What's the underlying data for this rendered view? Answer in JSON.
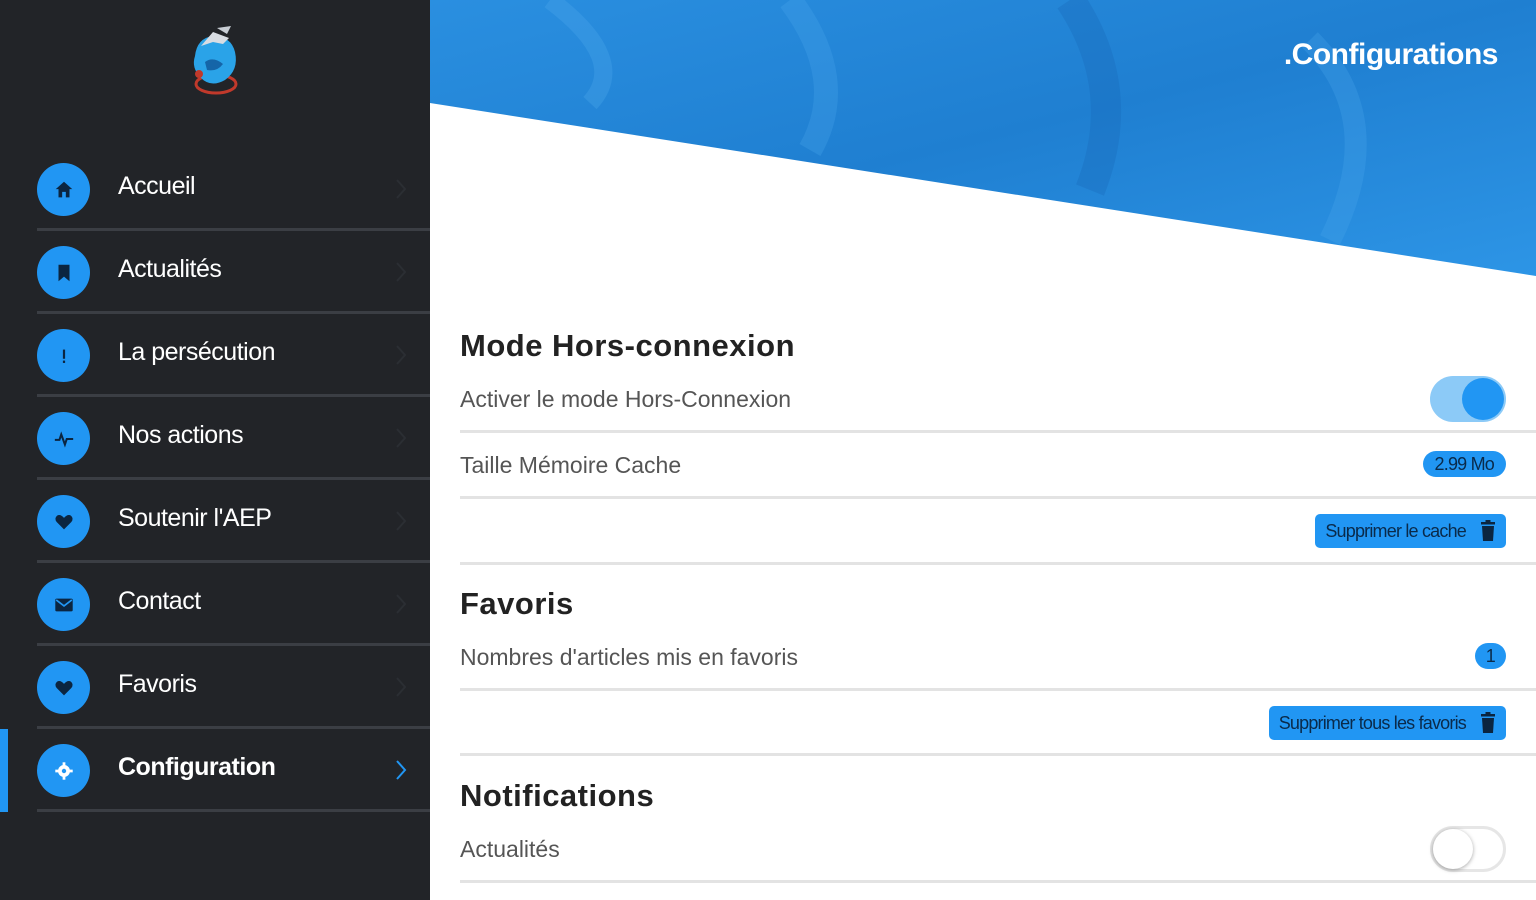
{
  "sidebar": {
    "items": [
      {
        "label": "Accueil",
        "icon": "home-icon"
      },
      {
        "label": "Actualités",
        "icon": "bookmark-icon"
      },
      {
        "label": "La persécution",
        "icon": "alert-icon"
      },
      {
        "label": "Nos actions",
        "icon": "pulse-icon"
      },
      {
        "label": "Soutenir l'AEP",
        "icon": "heart-icon"
      },
      {
        "label": "Contact",
        "icon": "mail-icon"
      },
      {
        "label": "Favoris",
        "icon": "heart-icon"
      },
      {
        "label": "Configuration",
        "icon": "settings-icon",
        "active": true
      }
    ]
  },
  "header": {
    "title": ".Configurations"
  },
  "offline": {
    "title": "Mode Hors-connexion",
    "toggle_label": "Activer le mode Hors-Connexion",
    "toggle_on": true,
    "cache_label": "Taille Mémoire Cache",
    "cache_size": "2.99 Mo",
    "clear_cache_label": "Supprimer le cache"
  },
  "favorites": {
    "title": "Favoris",
    "count_label": "Nombres d'articles mis en favoris",
    "count": "1",
    "clear_label": "Supprimer tous les favoris"
  },
  "notifications": {
    "title": "Notifications",
    "news_label": "Actualités",
    "news_on": false
  },
  "colors": {
    "accent": "#2196f3",
    "sidebar_bg": "#222428",
    "hero_blue": "#1e7fd0"
  }
}
